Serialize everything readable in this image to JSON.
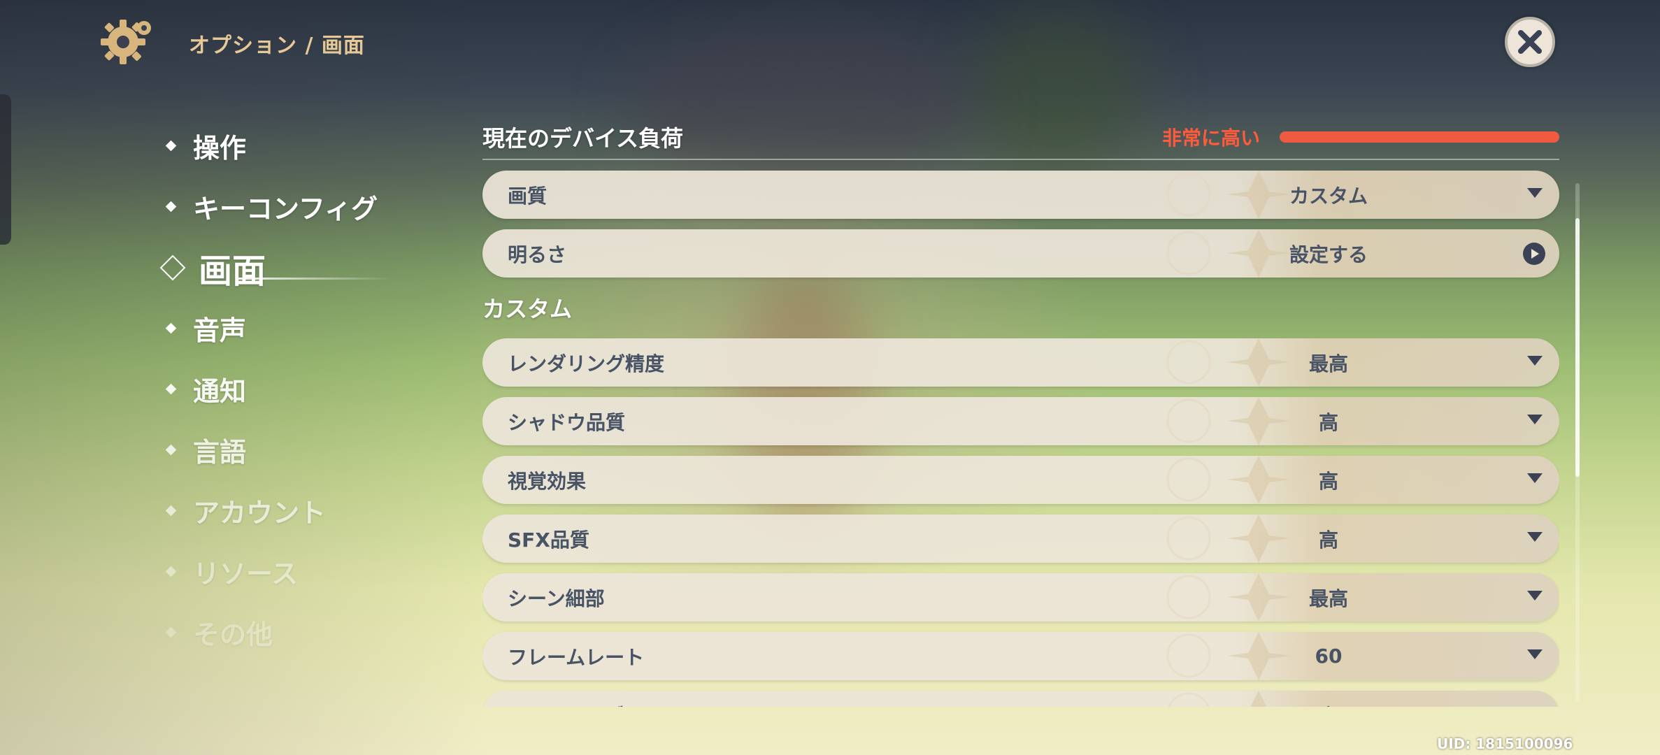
{
  "header": {
    "breadcrumb": "オプション / 画面",
    "gear_icon": "gear-icon",
    "close_icon": "close-icon"
  },
  "nav": {
    "items": [
      {
        "label": "操作",
        "active": false
      },
      {
        "label": "キーコンフィグ",
        "active": false
      },
      {
        "label": "画面",
        "active": true
      },
      {
        "label": "音声",
        "active": false
      },
      {
        "label": "通知",
        "active": false
      },
      {
        "label": "言語",
        "active": false
      },
      {
        "label": "アカウント",
        "active": false
      },
      {
        "label": "リソース",
        "active": false
      },
      {
        "label": "その他",
        "active": false
      }
    ]
  },
  "device_load": {
    "title": "現在のデバイス負荷",
    "status": "非常に高い",
    "level": 1.0,
    "color": "#f05a3e"
  },
  "general_rows": [
    {
      "label": "画質",
      "value": "カスタム",
      "control": "dropdown"
    },
    {
      "label": "明るさ",
      "value": "設定する",
      "control": "link"
    }
  ],
  "custom": {
    "title": "カスタム",
    "rows": [
      {
        "label": "レンダリング精度",
        "value": "最高"
      },
      {
        "label": "シャドウ品質",
        "value": "高"
      },
      {
        "label": "視覚効果",
        "value": "高"
      },
      {
        "label": "SFX品質",
        "value": "高"
      },
      {
        "label": "シーン細部",
        "value": "最高"
      },
      {
        "label": "フレームレート",
        "value": "60"
      },
      {
        "label": "モーションブラー",
        "value": "高"
      }
    ]
  },
  "uid": "UID: 1815100096",
  "colors": {
    "accent_gold": "#e7c897",
    "row_text": "#495366",
    "warning": "#ff5a3c"
  }
}
